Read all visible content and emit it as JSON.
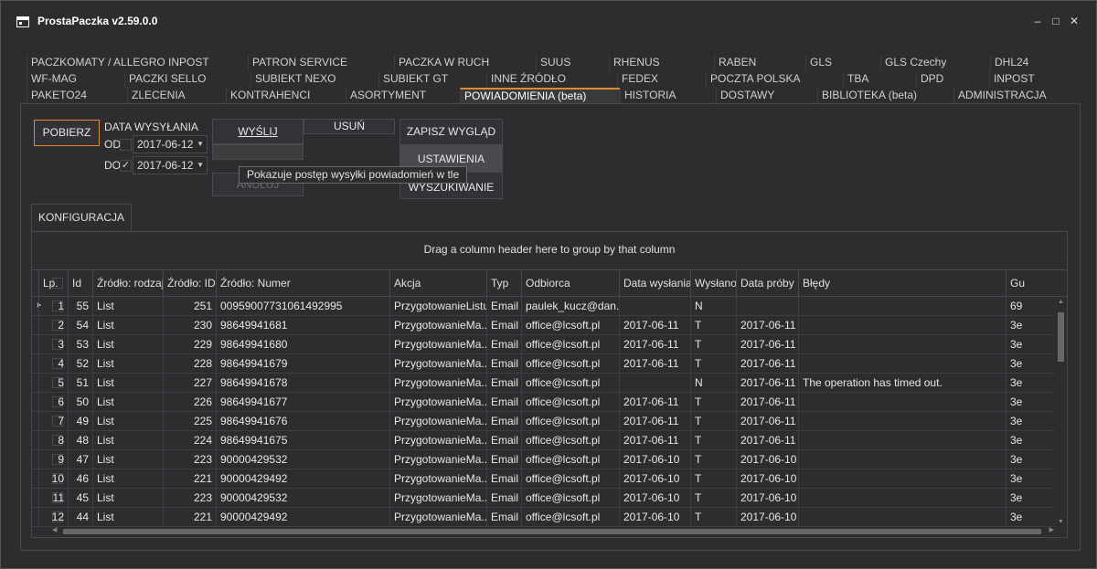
{
  "window": {
    "title": "ProstaPaczka v2.59.0.0",
    "minimize": "–",
    "maximize": "□",
    "close": "✕"
  },
  "tabs": {
    "row1": [
      "PACZKOMATY / ALLEGRO INPOST",
      "PATRON SERVICE",
      "PACZKA W RUCH",
      "SUUS",
      "RHENUS",
      "RABEN",
      "GLS",
      "GLS Czechy",
      "DHL24"
    ],
    "row2": [
      "WF-MAG",
      "PACZKI SELLO",
      "SUBIEKT NEXO",
      "SUBIEKT GT",
      "INNE ŹRÓDŁO",
      "FEDEX",
      "POCZTA POLSKA",
      "TBA",
      "DPD",
      "INPOST"
    ],
    "row3": [
      "PAKETO24",
      "ZLECENIA",
      "KONTRAHENCI",
      "ASORTYMENT",
      "POWIADOMIENIA (beta)",
      "HISTORIA",
      "DOSTAWY",
      "BIBLIOTEKA (beta)",
      "ADMINISTRACJA"
    ],
    "active": "POWIADOMIENIA (beta)",
    "accent": "#e38b2c"
  },
  "toolbar": {
    "pobierz": "POBIERZ",
    "data_wyslania": "DATA WYSYŁANIA",
    "od_label": "OD",
    "do_label": "DO",
    "od_date": "2017-06-12",
    "do_date": "2017-06-12",
    "od_checked": false,
    "do_checked": true,
    "wyslij": "WYŚLIJ",
    "usun": "USUŃ",
    "anuluj": "ANULUJ",
    "zapisz": "ZAPISZ WYGLĄD",
    "ustawienia": "USTAWIENIA",
    "wyszukiwanie": "WYSZUKIWANIE",
    "tooltip": "Pokazuje postęp wysyłki powiadomień w tle"
  },
  "konfiguracja": "KONFIGURACJA",
  "grid": {
    "group_hint": "Drag a column header here to group by that column",
    "columns": [
      "Lp.",
      "Id",
      "Źródło: rodzaj",
      "Źródło: ID",
      "Źródło: Numer",
      "Akcja",
      "Typ",
      "Odbiorca",
      "Data wysłania",
      "Wysłano",
      "Data próby",
      "Błędy",
      "Gu"
    ],
    "rows": [
      {
        "lp": "1",
        "id": "55",
        "rodzaj": "List",
        "zid": "251",
        "numer": "00959007731061492995",
        "akcja": "PrzygotowanieListu",
        "typ": "Email",
        "odbiorca": "paulek_kucz@dan...",
        "data": "",
        "wyslano": "N",
        "proba": "",
        "bledy": "",
        "gu": "69"
      },
      {
        "lp": "2",
        "id": "54",
        "rodzaj": "List",
        "zid": "230",
        "numer": "98649941681",
        "akcja": "PrzygotowanieMa...",
        "typ": "Email",
        "odbiorca": "office@lcsoft.pl",
        "data": "2017-06-11",
        "wyslano": "T",
        "proba": "2017-06-11",
        "bledy": "",
        "gu": "3e"
      },
      {
        "lp": "3",
        "id": "53",
        "rodzaj": "List",
        "zid": "229",
        "numer": "98649941680",
        "akcja": "PrzygotowanieMa...",
        "typ": "Email",
        "odbiorca": "office@lcsoft.pl",
        "data": "2017-06-11",
        "wyslano": "T",
        "proba": "2017-06-11",
        "bledy": "",
        "gu": "3e"
      },
      {
        "lp": "4",
        "id": "52",
        "rodzaj": "List",
        "zid": "228",
        "numer": "98649941679",
        "akcja": "PrzygotowanieMa...",
        "typ": "Email",
        "odbiorca": "office@lcsoft.pl",
        "data": "2017-06-11",
        "wyslano": "T",
        "proba": "2017-06-11",
        "bledy": "",
        "gu": "3e"
      },
      {
        "lp": "5",
        "id": "51",
        "rodzaj": "List",
        "zid": "227",
        "numer": "98649941678",
        "akcja": "PrzygotowanieMa...",
        "typ": "Email",
        "odbiorca": "office@lcsoft.pl",
        "data": "",
        "wyslano": "N",
        "proba": "2017-06-11",
        "bledy": "The operation has timed out.",
        "gu": "3e"
      },
      {
        "lp": "6",
        "id": "50",
        "rodzaj": "List",
        "zid": "226",
        "numer": "98649941677",
        "akcja": "PrzygotowanieMa...",
        "typ": "Email",
        "odbiorca": "office@lcsoft.pl",
        "data": "2017-06-11",
        "wyslano": "T",
        "proba": "2017-06-11",
        "bledy": "",
        "gu": "3e"
      },
      {
        "lp": "7",
        "id": "49",
        "rodzaj": "List",
        "zid": "225",
        "numer": "98649941676",
        "akcja": "PrzygotowanieMa...",
        "typ": "Email",
        "odbiorca": "office@lcsoft.pl",
        "data": "2017-06-11",
        "wyslano": "T",
        "proba": "2017-06-11",
        "bledy": "",
        "gu": "3e"
      },
      {
        "lp": "8",
        "id": "48",
        "rodzaj": "List",
        "zid": "224",
        "numer": "98649941675",
        "akcja": "PrzygotowanieMa...",
        "typ": "Email",
        "odbiorca": "office@lcsoft.pl",
        "data": "2017-06-11",
        "wyslano": "T",
        "proba": "2017-06-11",
        "bledy": "",
        "gu": "3e"
      },
      {
        "lp": "9",
        "id": "47",
        "rodzaj": "List",
        "zid": "223",
        "numer": "90000429532",
        "akcja": "PrzygotowanieMa...",
        "typ": "Email",
        "odbiorca": "office@lcsoft.pl",
        "data": "2017-06-10",
        "wyslano": "T",
        "proba": "2017-06-10",
        "bledy": "",
        "gu": "3e"
      },
      {
        "lp": "10",
        "id": "46",
        "rodzaj": "List",
        "zid": "221",
        "numer": "90000429492",
        "akcja": "PrzygotowanieMa...",
        "typ": "Email",
        "odbiorca": "office@lcsoft.pl",
        "data": "2017-06-10",
        "wyslano": "T",
        "proba": "2017-06-10",
        "bledy": "",
        "gu": "3e"
      },
      {
        "lp": "11",
        "id": "45",
        "rodzaj": "List",
        "zid": "223",
        "numer": "90000429532",
        "akcja": "PrzygotowanieMa...",
        "typ": "Email",
        "odbiorca": "office@lcsoft.pl",
        "data": "2017-06-10",
        "wyslano": "T",
        "proba": "2017-06-10",
        "bledy": "",
        "gu": "3e"
      },
      {
        "lp": "12",
        "id": "44",
        "rodzaj": "List",
        "zid": "221",
        "numer": "90000429492",
        "akcja": "PrzygotowanieMa...",
        "typ": "Email",
        "odbiorca": "office@lcsoft.pl",
        "data": "2017-06-10",
        "wyslano": "T",
        "proba": "2017-06-10",
        "bledy": "",
        "gu": "3e"
      }
    ]
  }
}
